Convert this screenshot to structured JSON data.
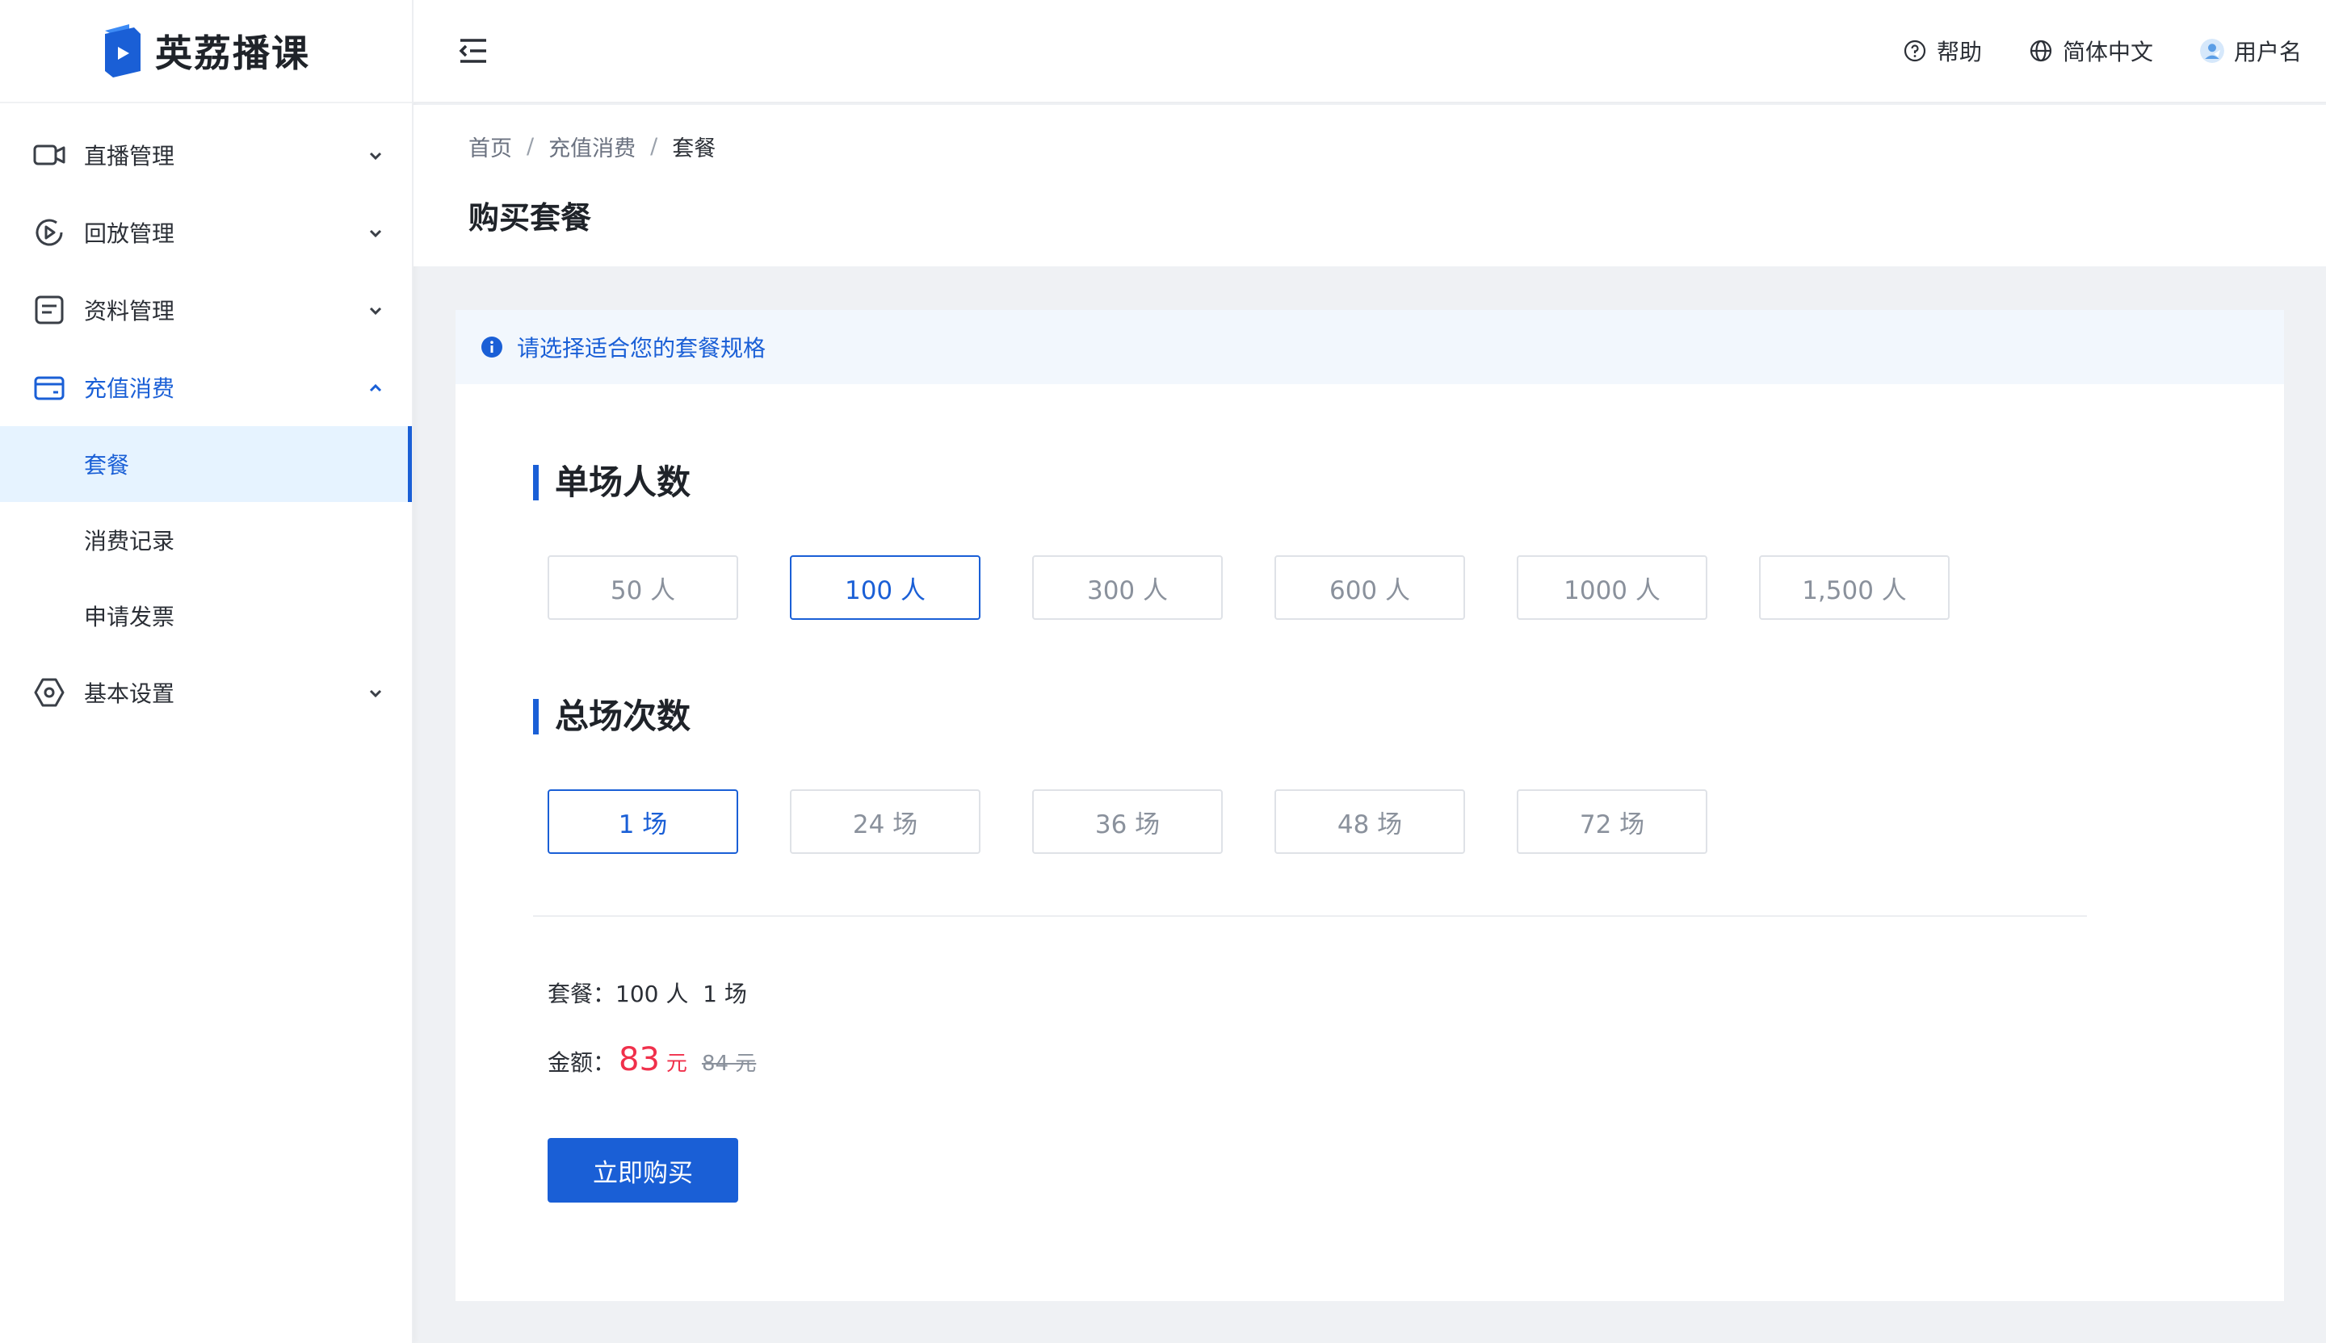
{
  "brand": {
    "name": "英荔播课",
    "color": "#1a5fd6"
  },
  "sidebar": {
    "items": [
      {
        "label": "直播管理",
        "icon": "video-camera-icon",
        "expanded": false
      },
      {
        "label": "回放管理",
        "icon": "replay-icon",
        "expanded": false
      },
      {
        "label": "资料管理",
        "icon": "document-icon",
        "expanded": false
      },
      {
        "label": "充值消费",
        "icon": "wallet-icon",
        "expanded": true,
        "children": [
          {
            "label": "套餐",
            "selected": true
          },
          {
            "label": "消费记录",
            "selected": false
          },
          {
            "label": "申请发票",
            "selected": false
          }
        ]
      },
      {
        "label": "基本设置",
        "icon": "settings-icon",
        "expanded": false
      }
    ]
  },
  "header": {
    "help": "帮助",
    "language": "简体中文",
    "username": "用户名"
  },
  "breadcrumb": [
    "首页",
    "充值消费",
    "套餐"
  ],
  "page_title": "购买套餐",
  "alert": "请选择适合您的套餐规格",
  "audience": {
    "title": "单场人数",
    "options": [
      "50 人",
      "100 人",
      "300 人",
      "600 人",
      "1000 人",
      "1,500 人"
    ],
    "selected_index": 1
  },
  "sessions": {
    "title": "总场次数",
    "options": [
      "1 场",
      "24 场",
      "36 场",
      "48 场",
      "72 场"
    ],
    "selected_index": 0
  },
  "summary": {
    "package_label": "套餐：",
    "package_value": "100 人  1 场",
    "amount_label": "金额：",
    "price": "83",
    "price_unit": "元",
    "original_price": "84 元"
  },
  "buy_button": "立即购买",
  "colors": {
    "accent": "#1a5fd6",
    "price": "#f0304b",
    "selected_bg": "#e6f3ff"
  }
}
